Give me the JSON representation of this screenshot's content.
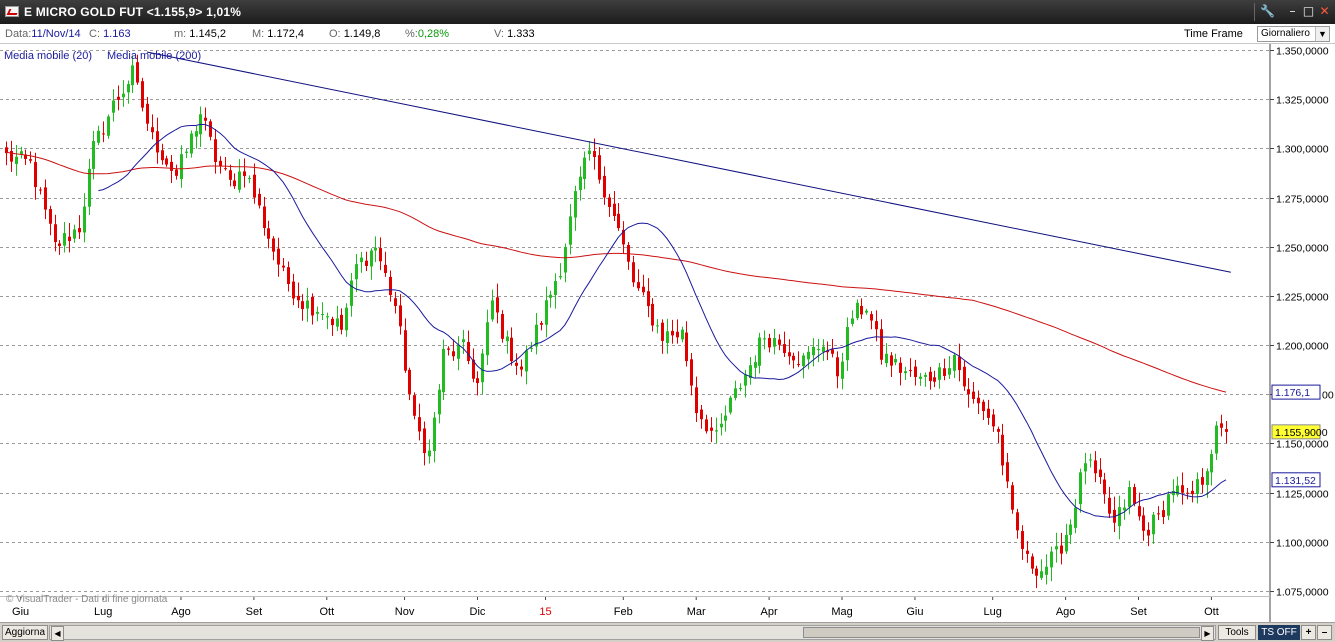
{
  "window": {
    "title": "E MICRO GOLD FUT <1.155,9> 1,01%",
    "buttons": [
      "🔧",
      "–",
      "□",
      "✕"
    ]
  },
  "infobar": {
    "date_label": "Data:",
    "date_value": "11/Nov/14",
    "close_label": "C:",
    "close_value": "1.163",
    "low_label": "m:",
    "low_value": "1.145,2",
    "high_label": "M:",
    "high_value": "1.172,4",
    "open_label": "O:",
    "open_value": "1.149,8",
    "pct_label": "%:",
    "pct_value": "0,28%",
    "vol_label": "V:",
    "vol_value": "1.333",
    "timeframe_label": "Time Frame",
    "timeframe_value": "Giornaliero"
  },
  "legend": {
    "ma20": "Media mobile (20)",
    "ma200": "Media mobile (200)"
  },
  "copyright": "© VisualTrader - Dati di fine giornata",
  "bottombar": {
    "refresh_label": "Aggiorna",
    "tools_label": "Tools",
    "ts_label": "TS OFF",
    "plus_label": "+",
    "minus_label": "–"
  },
  "colors": {
    "up": "#22bb22",
    "down": "#e00000",
    "ma20": "#1a1a9c",
    "ma200": "#cc1111",
    "trendline": "#101080",
    "last_price_bg": "#ffff33"
  },
  "chart_data": {
    "type": "candlestick",
    "title": "E MICRO GOLD FUT",
    "ylim": [
      1065,
      1352
    ],
    "y_ticks": [
      "1.350,0000",
      "1.325,0000",
      "1.300,0000",
      "1.275,0000",
      "1.250,0000",
      "1.225,0000",
      "1.200,0000",
      "1.175,0000",
      "1.150,0000",
      "1.125,0000",
      "1.100,0000",
      "1.075,0000"
    ],
    "y_tick_values": [
      1350,
      1325,
      1300,
      1275,
      1250,
      1225,
      1200,
      1175,
      1150,
      1125,
      1100,
      1075
    ],
    "x_labels": [
      "Giu",
      "Lug",
      "Ago",
      "Set",
      "Ott",
      "Nov",
      "Dic",
      "15",
      "Feb",
      "Mar",
      "Apr",
      "Mag",
      "Giu",
      "Lug",
      "Ago",
      "Set",
      "Ott"
    ],
    "x_label_bar_index": [
      3,
      20,
      36,
      51,
      66,
      82,
      97,
      111,
      127,
      142,
      157,
      172,
      187,
      203,
      218,
      233,
      248
    ],
    "bar_count": 252,
    "close_anchors": [
      [
        0,
        1296
      ],
      [
        5,
        1292
      ],
      [
        10,
        1250
      ],
      [
        15,
        1260
      ],
      [
        18,
        1300
      ],
      [
        22,
        1322
      ],
      [
        26,
        1338
      ],
      [
        30,
        1305
      ],
      [
        35,
        1286
      ],
      [
        38,
        1305
      ],
      [
        40,
        1318
      ],
      [
        43,
        1295
      ],
      [
        46,
        1282
      ],
      [
        49,
        1290
      ],
      [
        53,
        1262
      ],
      [
        57,
        1235
      ],
      [
        61,
        1222
      ],
      [
        65,
        1218
      ],
      [
        69,
        1208
      ],
      [
        72,
        1240
      ],
      [
        76,
        1250
      ],
      [
        80,
        1220
      ],
      [
        84,
        1160
      ],
      [
        87,
        1145
      ],
      [
        90,
        1195
      ],
      [
        94,
        1198
      ],
      [
        97,
        1180
      ],
      [
        100,
        1222
      ],
      [
        103,
        1200
      ],
      [
        106,
        1188
      ],
      [
        110,
        1213
      ],
      [
        114,
        1240
      ],
      [
        117,
        1275
      ],
      [
        120,
        1298
      ],
      [
        123,
        1280
      ],
      [
        126,
        1258
      ],
      [
        129,
        1232
      ],
      [
        132,
        1218
      ],
      [
        135,
        1205
      ],
      [
        139,
        1206
      ],
      [
        142,
        1168
      ],
      [
        146,
        1152
      ],
      [
        149,
        1170
      ],
      [
        153,
        1190
      ],
      [
        156,
        1205
      ],
      [
        160,
        1200
      ],
      [
        164,
        1192
      ],
      [
        168,
        1202
      ],
      [
        171,
        1186
      ],
      [
        174,
        1215
      ],
      [
        177,
        1220
      ],
      [
        180,
        1195
      ],
      [
        184,
        1188
      ],
      [
        188,
        1182
      ],
      [
        192,
        1186
      ],
      [
        195,
        1195
      ],
      [
        198,
        1173
      ],
      [
        201,
        1168
      ],
      [
        204,
        1155
      ],
      [
        207,
        1112
      ],
      [
        210,
        1090
      ],
      [
        213,
        1086
      ],
      [
        216,
        1093
      ],
      [
        219,
        1110
      ],
      [
        222,
        1142
      ],
      [
        225,
        1128
      ],
      [
        228,
        1108
      ],
      [
        231,
        1125
      ],
      [
        234,
        1105
      ],
      [
        237,
        1112
      ],
      [
        240,
        1128
      ],
      [
        243,
        1120
      ],
      [
        246,
        1132
      ],
      [
        249,
        1155
      ]
    ],
    "ma20_label": "Media mobile (20)",
    "ma200_label": "Media mobile (200)",
    "ma200_end_value": 1176.1,
    "ma20_end_value": 1131.52,
    "last_price": 1155.9,
    "ma200_tag": "1.176,1",
    "ma20_tag": "1.131,52",
    "last_tag": "1.155,9000",
    "trendline": {
      "from_bar": 29,
      "from_value": 1349,
      "to_bar": 252,
      "to_value": 1237
    },
    "grid": "horizontal-dashed"
  }
}
